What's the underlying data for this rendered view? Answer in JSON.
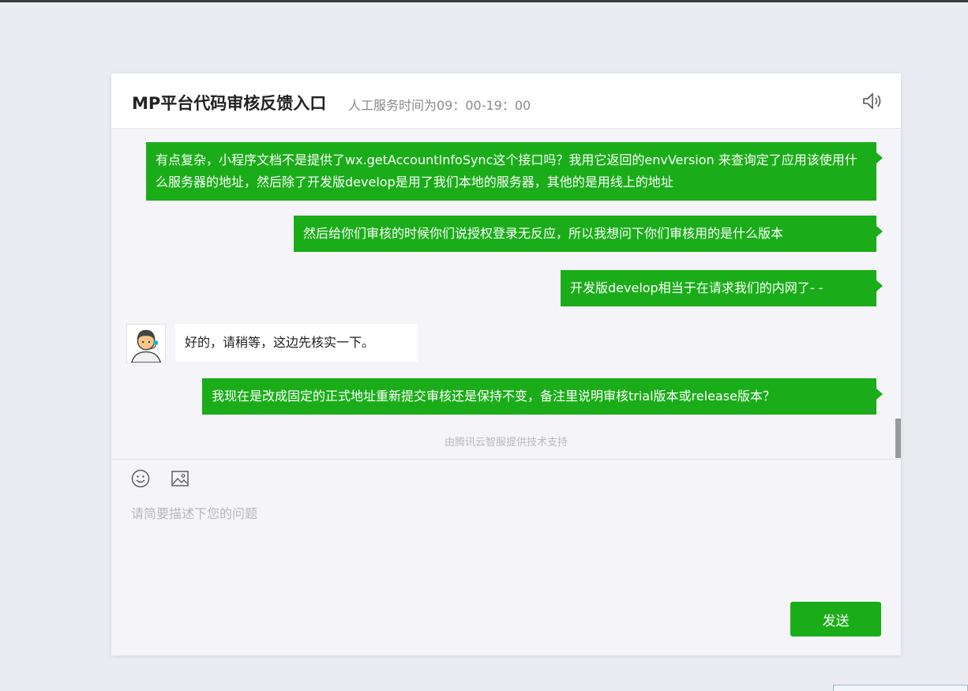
{
  "header": {
    "title": "MP平台代码审核反馈入口",
    "service_hours": "人工服务时间为09：00-19：00",
    "speaker_icon": "speaker-icon"
  },
  "messages": [
    {
      "side": "out",
      "text": "有点复杂，小程序文档不是提供了wx.getAccountInfoSync这个接口吗？我用它返回的envVersion 来查询定了应用该使用什么服务器的地址，然后除了开发版develop是用了我们本地的服务器，其他的是用线上的地址"
    },
    {
      "side": "out",
      "text": "然后给你们审核的时候你们说授权登录无反应，所以我想问下你们审核用的是什么版本"
    },
    {
      "side": "out",
      "text": "开发版develop相当于在请求我们的内网了- -"
    },
    {
      "side": "in",
      "text": "好的，请稍等，这边先核实一下。"
    },
    {
      "side": "out",
      "text": "我现在是改成固定的正式地址重新提交审核还是保持不变，备注里说明审核trial版本或release版本？"
    }
  ],
  "powered_by": "由腾讯云智服提供技术支持",
  "composer": {
    "emoji_icon": "emoji-icon",
    "image_icon": "image-icon",
    "placeholder": "请简要描述下您的问题",
    "value": "",
    "send_label": "发送"
  },
  "colors": {
    "accent": "#1aad19",
    "background": "#ebecf1",
    "panel": "#f5f5f9"
  }
}
